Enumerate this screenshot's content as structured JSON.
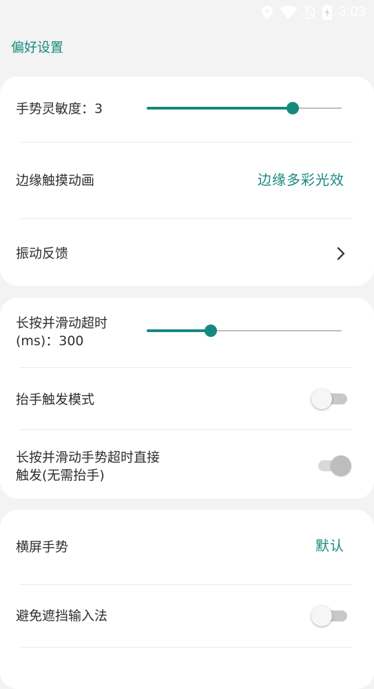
{
  "status_bar": {
    "time": "3:03",
    "icons": [
      "location-icon",
      "wifi-icon",
      "no-sim-icon",
      "battery-icon"
    ]
  },
  "header": {
    "title": "偏好设置"
  },
  "colors": {
    "accent": "#15897f",
    "background": "#f3f3f3",
    "card": "#ffffff"
  },
  "card1": {
    "gesture_sensitivity": {
      "label": "手势灵敏度：3",
      "fraction": 0.75
    },
    "edge_touch_animation": {
      "label": "边缘触摸动画",
      "value": "边缘多彩光效"
    },
    "vibration_feedback": {
      "label": "振动反馈"
    }
  },
  "card2": {
    "long_press_timeout": {
      "label_line1": "长按并滑动超时",
      "label_line2": "(ms)：300",
      "fraction": 0.33
    },
    "lift_trigger_mode": {
      "label": "抬手触发模式",
      "checked": false
    },
    "timeout_direct_trigger": {
      "label_line1": "长按并滑动手势超时直接",
      "label_line2": "触发(无需抬手)",
      "checked": true,
      "disabled": true
    }
  },
  "card3": {
    "landscape_gesture": {
      "label": "横屏手势",
      "value": "默认"
    },
    "avoid_ime": {
      "label": "避免遮挡输入法",
      "checked": false
    }
  }
}
